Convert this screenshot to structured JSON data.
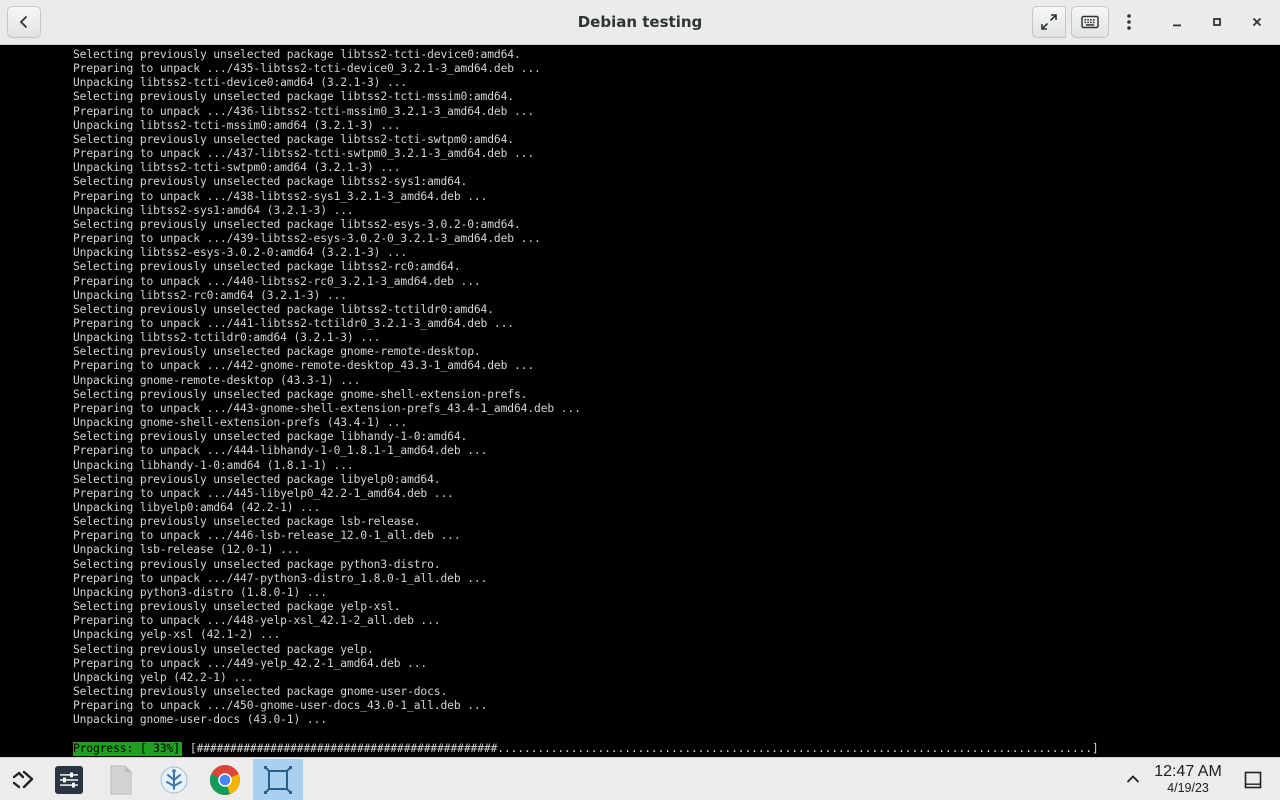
{
  "window": {
    "title": "Debian testing",
    "back_icon": "back-arrow-icon",
    "fullscreen_icon": "fullscreen-icon",
    "keyboard_icon": "keyboard-icon",
    "menu_icon": "kebab-menu-icon"
  },
  "terminal": {
    "lines": [
      "Selecting previously unselected package libtss2-tcti-device0:amd64.",
      "Preparing to unpack .../435-libtss2-tcti-device0_3.2.1-3_amd64.deb ...",
      "Unpacking libtss2-tcti-device0:amd64 (3.2.1-3) ...",
      "Selecting previously unselected package libtss2-tcti-mssim0:amd64.",
      "Preparing to unpack .../436-libtss2-tcti-mssim0_3.2.1-3_amd64.deb ...",
      "Unpacking libtss2-tcti-mssim0:amd64 (3.2.1-3) ...",
      "Selecting previously unselected package libtss2-tcti-swtpm0:amd64.",
      "Preparing to unpack .../437-libtss2-tcti-swtpm0_3.2.1-3_amd64.deb ...",
      "Unpacking libtss2-tcti-swtpm0:amd64 (3.2.1-3) ...",
      "Selecting previously unselected package libtss2-sys1:amd64.",
      "Preparing to unpack .../438-libtss2-sys1_3.2.1-3_amd64.deb ...",
      "Unpacking libtss2-sys1:amd64 (3.2.1-3) ...",
      "Selecting previously unselected package libtss2-esys-3.0.2-0:amd64.",
      "Preparing to unpack .../439-libtss2-esys-3.0.2-0_3.2.1-3_amd64.deb ...",
      "Unpacking libtss2-esys-3.0.2-0:amd64 (3.2.1-3) ...",
      "Selecting previously unselected package libtss2-rc0:amd64.",
      "Preparing to unpack .../440-libtss2-rc0_3.2.1-3_amd64.deb ...",
      "Unpacking libtss2-rc0:amd64 (3.2.1-3) ...",
      "Selecting previously unselected package libtss2-tctildr0:amd64.",
      "Preparing to unpack .../441-libtss2-tctildr0_3.2.1-3_amd64.deb ...",
      "Unpacking libtss2-tctildr0:amd64 (3.2.1-3) ...",
      "Selecting previously unselected package gnome-remote-desktop.",
      "Preparing to unpack .../442-gnome-remote-desktop_43.3-1_amd64.deb ...",
      "Unpacking gnome-remote-desktop (43.3-1) ...",
      "Selecting previously unselected package gnome-shell-extension-prefs.",
      "Preparing to unpack .../443-gnome-shell-extension-prefs_43.4-1_amd64.deb ...",
      "Unpacking gnome-shell-extension-prefs (43.4-1) ...",
      "Selecting previously unselected package libhandy-1-0:amd64.",
      "Preparing to unpack .../444-libhandy-1-0_1.8.1-1_amd64.deb ...",
      "Unpacking libhandy-1-0:amd64 (1.8.1-1) ...",
      "Selecting previously unselected package libyelp0:amd64.",
      "Preparing to unpack .../445-libyelp0_42.2-1_amd64.deb ...",
      "Unpacking libyelp0:amd64 (42.2-1) ...",
      "Selecting previously unselected package lsb-release.",
      "Preparing to unpack .../446-lsb-release_12.0-1_all.deb ...",
      "Unpacking lsb-release (12.0-1) ...",
      "Selecting previously unselected package python3-distro.",
      "Preparing to unpack .../447-python3-distro_1.8.0-1_all.deb ...",
      "Unpacking python3-distro (1.8.0-1) ...",
      "Selecting previously unselected package yelp-xsl.",
      "Preparing to unpack .../448-yelp-xsl_42.1-2_all.deb ...",
      "Unpacking yelp-xsl (42.1-2) ...",
      "Selecting previously unselected package yelp.",
      "Preparing to unpack .../449-yelp_42.2-1_amd64.deb ...",
      "Unpacking yelp (42.2-1) ...",
      "Selecting previously unselected package gnome-user-docs.",
      "Preparing to unpack .../450-gnome-user-docs_43.0-1_all.deb ...",
      "Unpacking gnome-user-docs (43.0-1) ..."
    ],
    "progress": {
      "label": "Progress: [ 33%]",
      "percent": 33,
      "bar": "[#############################################.........................................................................................]"
    },
    "colors": {
      "background": "#000000",
      "text": "#d4d4d4",
      "progress_label_bg": "#1fa01f"
    }
  },
  "taskbar": {
    "apps": [
      {
        "name": "launcher",
        "icon": "launcher-icon"
      },
      {
        "name": "settings",
        "icon": "settings-sliders-icon"
      },
      {
        "name": "files",
        "icon": "files-icon"
      },
      {
        "name": "crosvm",
        "icon": "crosvm-icon"
      },
      {
        "name": "chrome",
        "icon": "chrome-icon"
      },
      {
        "name": "terminal",
        "icon": "terminal-vm-icon",
        "active": true
      }
    ],
    "tray_chevron_icon": "chevron-up-icon",
    "clock": {
      "time": "12:47 AM",
      "date": "4/19/23"
    },
    "notification_icon": "notification-square-icon",
    "colors": {
      "active_app_bg": "#a9d0ee"
    }
  }
}
